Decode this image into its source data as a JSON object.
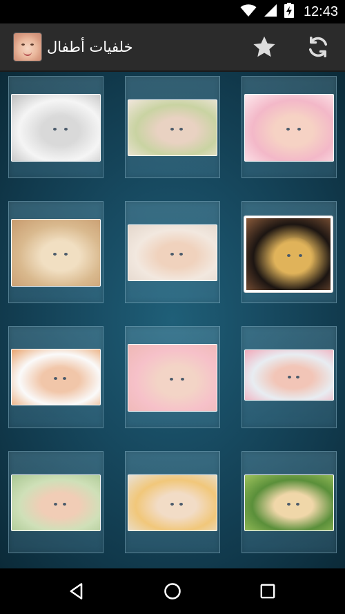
{
  "status_bar": {
    "time": "12:43",
    "icons": [
      "wifi-icon",
      "signal-icon",
      "battery-charging-icon"
    ]
  },
  "action_bar": {
    "title": "خلفيات أطفال",
    "app_icon": "baby-face-app-icon",
    "actions": [
      "star-icon",
      "refresh-icon"
    ]
  },
  "gallery": {
    "selected_index": 5,
    "items": [
      {
        "name": "baby-thumbnail-1",
        "desc": "baby-black-white",
        "colors": [
          "#f5f5f5",
          "#d9d9d9",
          "#bdbdbd"
        ]
      },
      {
        "name": "baby-thumbnail-2",
        "desc": "baby-under-green-blanket",
        "colors": [
          "#c9d3a2",
          "#e9d2c2",
          "#f1e6dc"
        ]
      },
      {
        "name": "baby-thumbnail-3",
        "desc": "baby-pink-towel",
        "colors": [
          "#f3b8c8",
          "#f6d2c4",
          "#fde8ec"
        ]
      },
      {
        "name": "baby-thumbnail-4",
        "desc": "mother-and-baby",
        "colors": [
          "#d9b98e",
          "#f1dfc2",
          "#c79a6d"
        ]
      },
      {
        "name": "baby-thumbnail-5",
        "desc": "baby-smiling-white",
        "colors": [
          "#f2e8df",
          "#f0d2bd",
          "#e4d7cc"
        ]
      },
      {
        "name": "baby-thumbnail-6",
        "desc": "baby-with-sunflowers",
        "colors": [
          "#1c1512",
          "#e0b35a",
          "#8a5a3a"
        ]
      },
      {
        "name": "baby-thumbnail-7",
        "desc": "babies-reading-books",
        "colors": [
          "#fafafa",
          "#f1c6a9",
          "#e9a26b"
        ]
      },
      {
        "name": "baby-thumbnail-8",
        "desc": "baby-pink-hat-closeup",
        "colors": [
          "#f6c1c9",
          "#f3d4c6",
          "#efb8b5"
        ]
      },
      {
        "name": "baby-thumbnail-9",
        "desc": "girl-resting-head",
        "colors": [
          "#e8edf2",
          "#f2c5b7",
          "#f2a9b9"
        ]
      },
      {
        "name": "baby-thumbnail-10",
        "desc": "baby-on-green-sheet",
        "colors": [
          "#cfe0b8",
          "#f1cdb6",
          "#a9c792"
        ]
      },
      {
        "name": "baby-thumbnail-11",
        "desc": "baby-in-yellow-towel",
        "colors": [
          "#f1c77a",
          "#f2dcc6",
          "#e8e1d7"
        ]
      },
      {
        "name": "baby-thumbnail-12",
        "desc": "girl-on-grass",
        "colors": [
          "#5a8f3a",
          "#f0d7a9",
          "#9fc35d"
        ]
      }
    ]
  },
  "nav_bar": {
    "buttons": [
      "back-icon",
      "home-icon",
      "recents-icon"
    ]
  }
}
